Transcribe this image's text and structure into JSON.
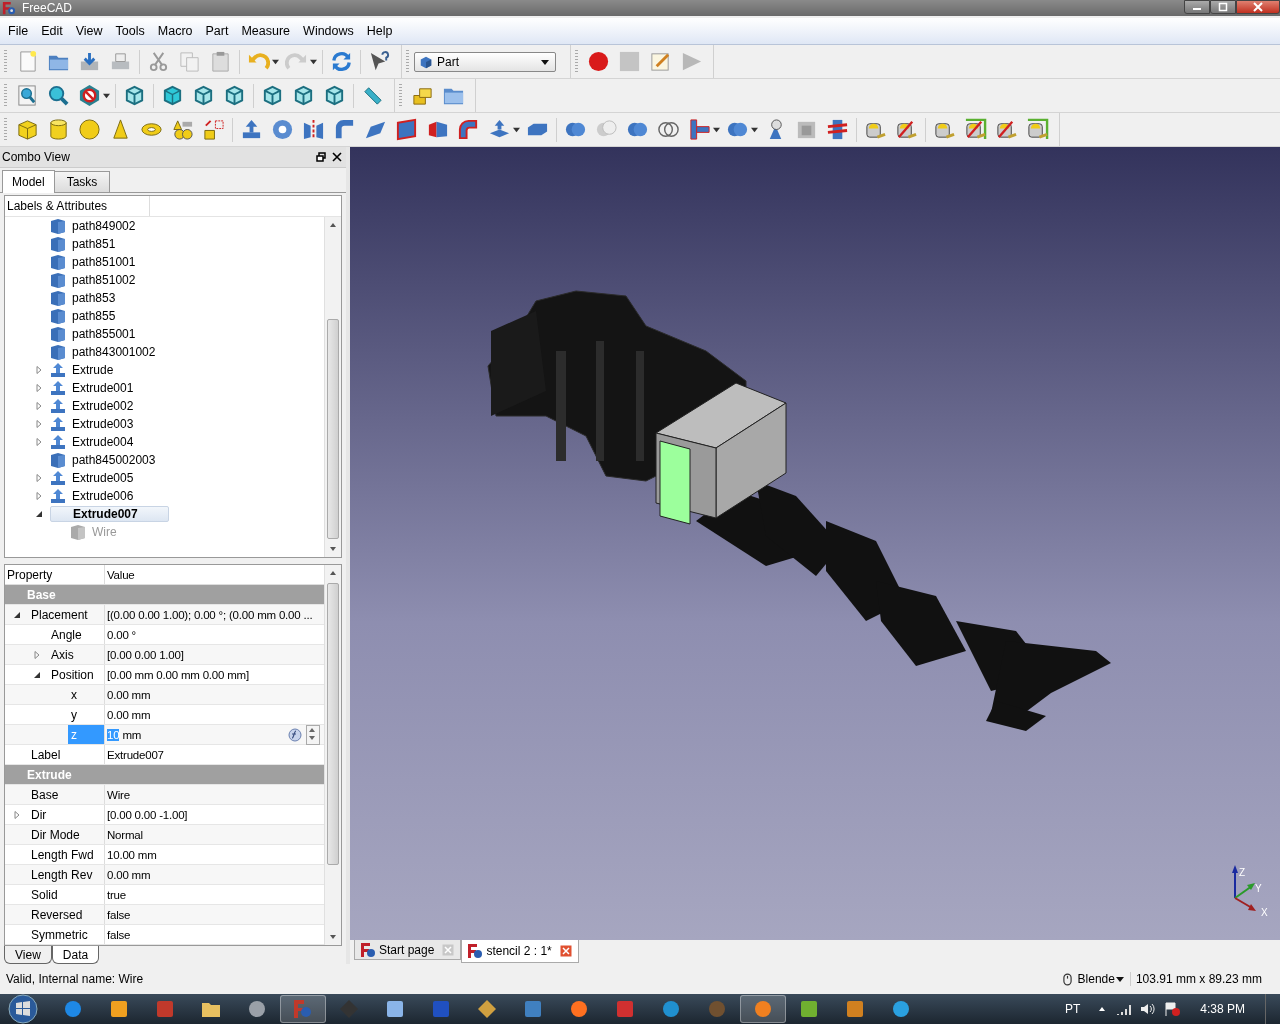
{
  "window": {
    "title": "FreeCAD"
  },
  "menu": [
    "File",
    "Edit",
    "View",
    "Tools",
    "Macro",
    "Part",
    "Measure",
    "Windows",
    "Help"
  ],
  "workbench": {
    "value": "Part"
  },
  "combo_view": {
    "title": "Combo View",
    "tabs": [
      {
        "label": "Model",
        "selected": true
      },
      {
        "label": "Tasks",
        "selected": false
      }
    ]
  },
  "tree": {
    "columns": [
      "Labels & Attributes"
    ],
    "items": [
      {
        "label": "path849002",
        "kind": "shape",
        "selected": false,
        "hidden": false
      },
      {
        "label": "path851",
        "kind": "shape",
        "selected": false,
        "hidden": false
      },
      {
        "label": "path851001",
        "kind": "shape",
        "selected": false,
        "hidden": false
      },
      {
        "label": "path851002",
        "kind": "shape",
        "selected": false,
        "hidden": false
      },
      {
        "label": "path853",
        "kind": "shape",
        "selected": false,
        "hidden": false
      },
      {
        "label": "path855",
        "kind": "shape",
        "selected": false,
        "hidden": false
      },
      {
        "label": "path855001",
        "kind": "shape",
        "selected": false,
        "hidden": false
      },
      {
        "label": "path843001002",
        "kind": "shape",
        "selected": false,
        "hidden": false
      },
      {
        "label": "Extrude",
        "kind": "extrude",
        "selected": false,
        "hidden": false,
        "expanded": false
      },
      {
        "label": "Extrude001",
        "kind": "extrude",
        "selected": false,
        "hidden": false,
        "expanded": false
      },
      {
        "label": "Extrude002",
        "kind": "extrude",
        "selected": false,
        "hidden": false,
        "expanded": false
      },
      {
        "label": "Extrude003",
        "kind": "extrude",
        "selected": false,
        "hidden": false,
        "expanded": false
      },
      {
        "label": "Extrude004",
        "kind": "extrude",
        "selected": false,
        "hidden": false,
        "expanded": false
      },
      {
        "label": "path845002003",
        "kind": "shape",
        "selected": false,
        "hidden": false
      },
      {
        "label": "Extrude005",
        "kind": "extrude",
        "selected": false,
        "hidden": false,
        "expanded": false
      },
      {
        "label": "Extrude006",
        "kind": "extrude",
        "selected": false,
        "hidden": false,
        "expanded": false
      },
      {
        "label": "Extrude007",
        "kind": "extrude",
        "selected": true,
        "hidden": false,
        "expanded": true,
        "children": [
          {
            "label": "Wire",
            "kind": "shape",
            "selected": false,
            "hidden": true
          }
        ]
      }
    ]
  },
  "properties": {
    "columns": [
      "Property",
      "Value"
    ],
    "groups": [
      {
        "name": "Base",
        "rows": [
          {
            "name": "Placement",
            "value": "[(0.00 0.00 1.00); 0.00 °; (0.00 mm  0.00 ...",
            "selected": false,
            "expanded": true,
            "children": [
              {
                "name": "Angle",
                "value": "0.00 °",
                "selected": false
              },
              {
                "name": "Axis",
                "value": "[0.00 0.00 1.00]",
                "selected": false,
                "expanded": false
              },
              {
                "name": "Position",
                "value": "[0.00 mm  0.00 mm  0.00 mm]",
                "selected": false,
                "expanded": true,
                "children": [
                  {
                    "name": "x",
                    "value": "0.00 mm",
                    "selected": false
                  },
                  {
                    "name": "y",
                    "value": "0.00 mm",
                    "selected": false
                  },
                  {
                    "name": "z",
                    "value": "10",
                    "unit": "mm",
                    "selected": true
                  }
                ]
              }
            ]
          },
          {
            "name": "Label",
            "value": "Extrude007",
            "selected": false
          }
        ]
      },
      {
        "name": "Extrude",
        "rows": [
          {
            "name": "Base",
            "value": "Wire",
            "selected": false
          },
          {
            "name": "Dir",
            "value": "[0.00 0.00 -1.00]",
            "selected": false,
            "expanded": false
          },
          {
            "name": "Dir Mode",
            "value": "Normal",
            "selected": false
          },
          {
            "name": "Length Fwd",
            "value": "10.00 mm",
            "selected": false
          },
          {
            "name": "Length Rev",
            "value": "0.00 mm",
            "selected": false
          },
          {
            "name": "Solid",
            "value": "true",
            "selected": false
          },
          {
            "name": "Reversed",
            "value": "false",
            "selected": false
          },
          {
            "name": "Symmetric",
            "value": "false",
            "selected": false
          }
        ]
      }
    ]
  },
  "property_tabs": [
    {
      "label": "View",
      "selected": false
    },
    {
      "label": "Data",
      "selected": true
    }
  ],
  "viewport": {
    "axis_labels": [
      "Z",
      "Y",
      "X"
    ]
  },
  "document_tabs": [
    {
      "label": "Start page",
      "selected": false
    },
    {
      "label": "stencil 2 : 1*",
      "selected": true
    }
  ],
  "status_bar": {
    "message": "Valid, Internal name: Wire",
    "navigation": "Blende",
    "dimensions": "103.91 mm x 89.23 mm"
  },
  "taskbar": {
    "language": "PT",
    "time": "4:38 PM"
  }
}
